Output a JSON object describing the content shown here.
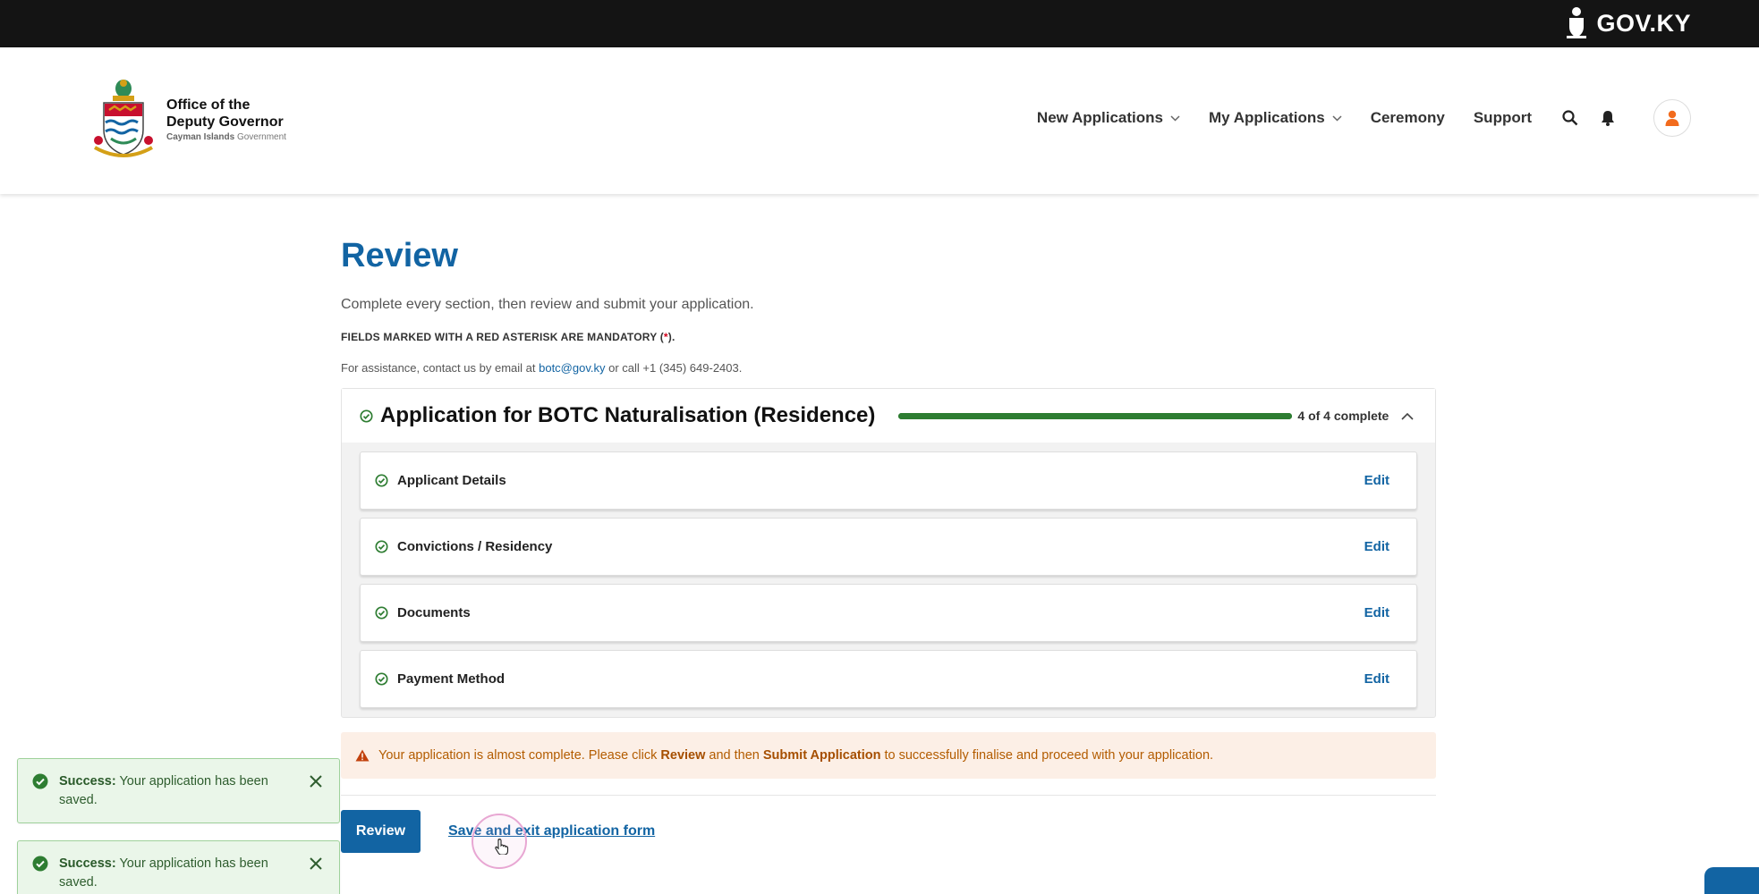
{
  "topbar": {
    "brand": "GOV.KY"
  },
  "header": {
    "org_line1": "Office of the",
    "org_line2": "Deputy Governor",
    "org_line3a": "Cayman Islands",
    "org_line3b": "Government",
    "nav": [
      {
        "label": "New Applications",
        "has_dropdown": true
      },
      {
        "label": "My Applications",
        "has_dropdown": true
      },
      {
        "label": "Ceremony",
        "has_dropdown": false
      },
      {
        "label": "Support",
        "has_dropdown": false
      }
    ],
    "icons": [
      "search-icon",
      "bell-icon",
      "user-icon"
    ]
  },
  "main": {
    "title": "Review",
    "intro": "Complete every section, then review and submit your application.",
    "mandatory_pre": "FIELDS MARKED WITH A RED ASTERISK ARE MANDATORY (",
    "mandatory_star": "*",
    "mandatory_post": ").",
    "assist_pre": "For assistance, contact us by email at ",
    "assist_email": "botc@gov.ky",
    "assist_post": " or call +1 (345) 649-2403."
  },
  "application": {
    "title": "Application for BOTC Naturalisation (Residence)",
    "progress_completed": 4,
    "progress_total": 4,
    "progress_label": "4 of 4 complete",
    "sections": [
      {
        "label": "Applicant Details",
        "action": "Edit"
      },
      {
        "label": "Convictions / Residency",
        "action": "Edit"
      },
      {
        "label": "Documents",
        "action": "Edit"
      },
      {
        "label": "Payment Method",
        "action": "Edit"
      }
    ]
  },
  "warning": {
    "pre": "Your application is almost complete. Please click ",
    "b1": "Review",
    "mid": " and then ",
    "b2": "Submit Application",
    "post": " to successfully finalise and proceed with your application."
  },
  "actions": {
    "review_label": "Review",
    "save_exit_label": "Save and exit application form"
  },
  "toasts": [
    {
      "label": "Success:",
      "message": "Your application has been saved."
    },
    {
      "label": "Success:",
      "message": "Your application has been saved."
    }
  ],
  "colors": {
    "primary": "#1264a3",
    "success": "#2e7d32",
    "warning_bg": "#fcefe6",
    "warning_text": "#b35c00",
    "topbar": "#141414"
  }
}
